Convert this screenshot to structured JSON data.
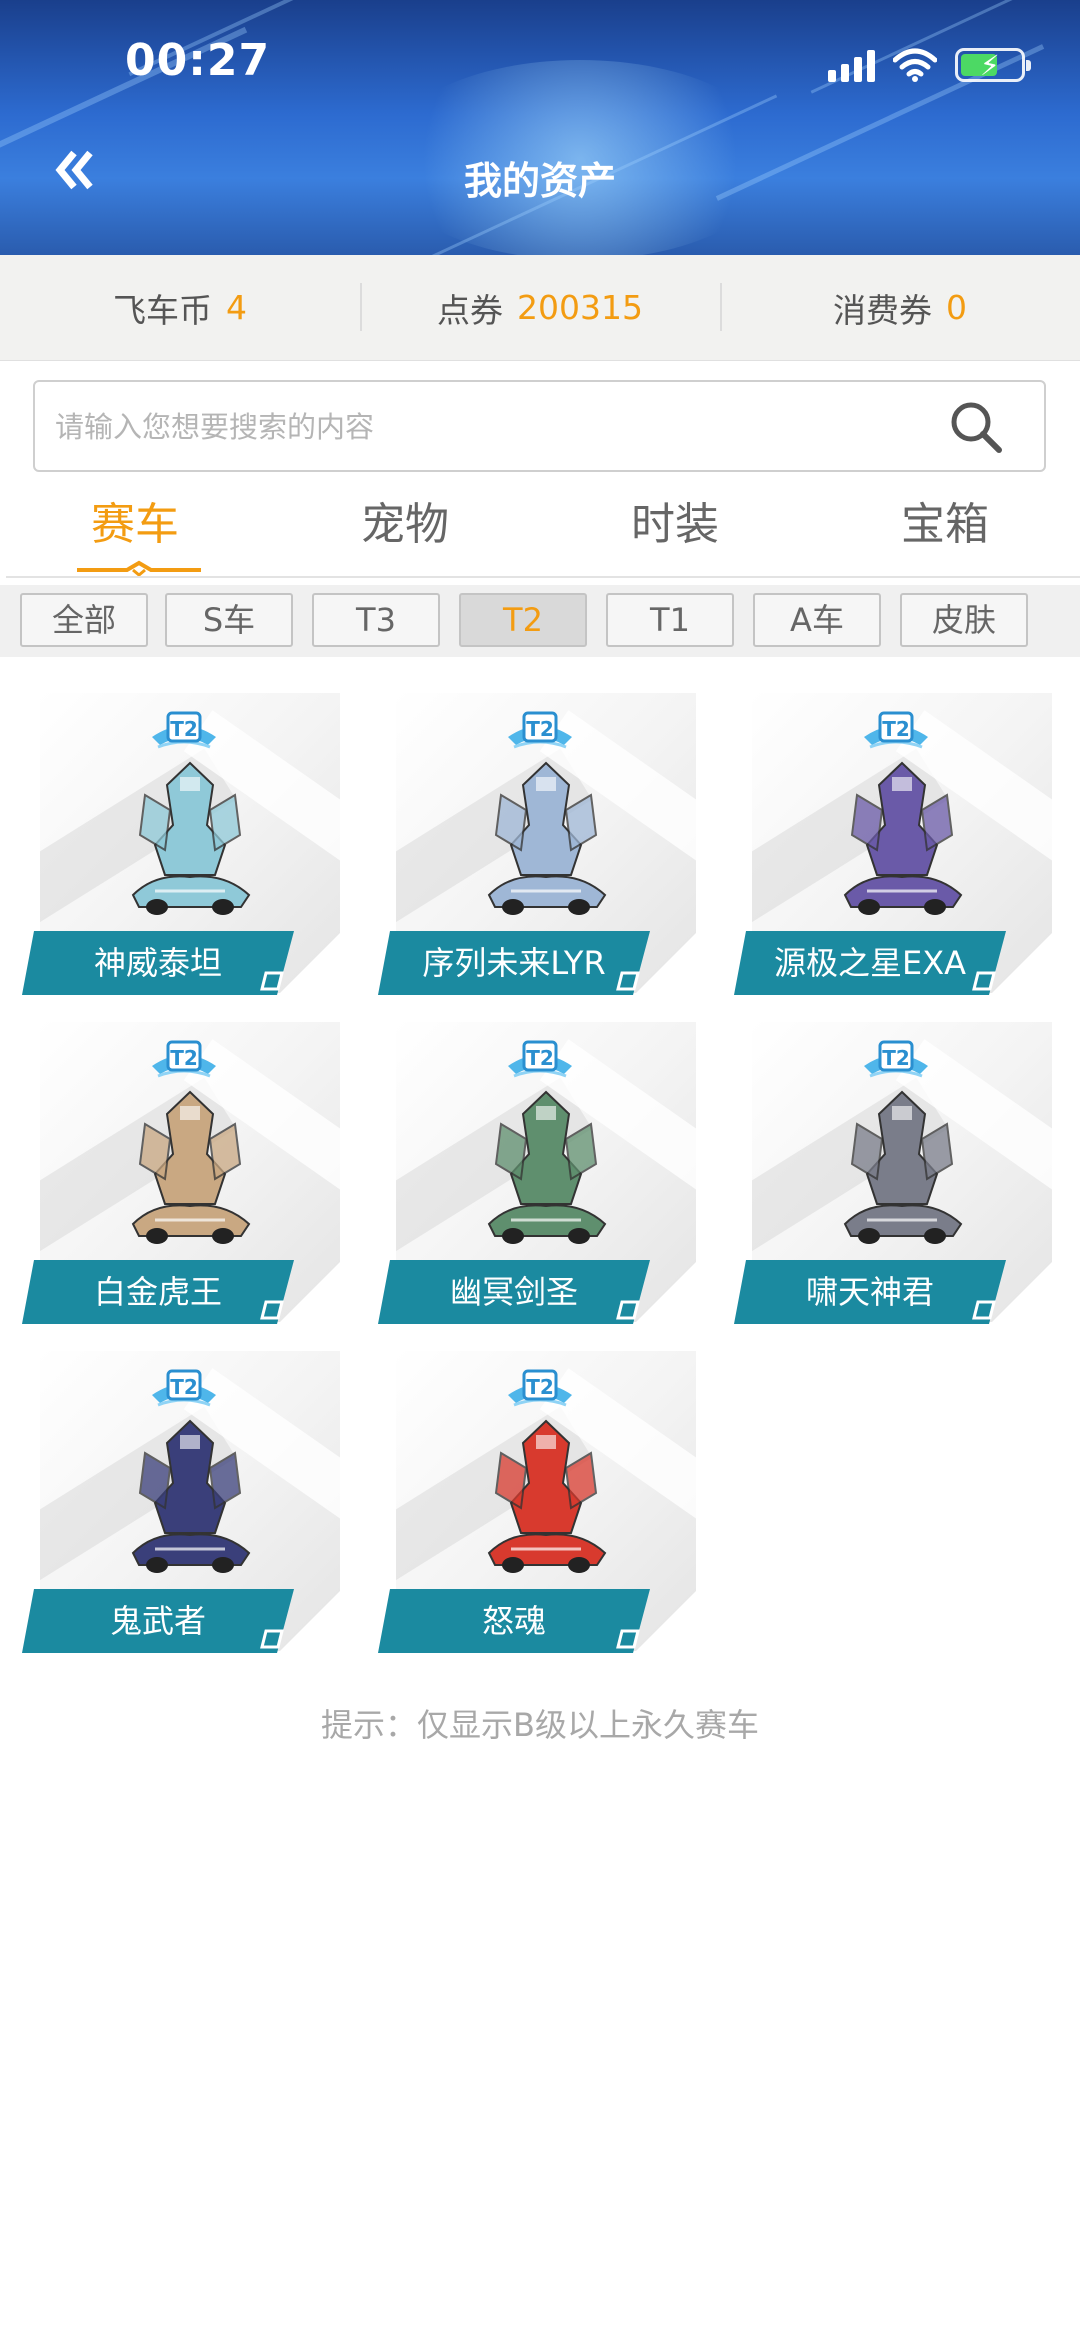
{
  "status_bar": {
    "time": "00:27"
  },
  "header": {
    "title": "我的资产",
    "back_icon": "double-chevron-left-icon"
  },
  "balance": [
    {
      "label": "飞车币",
      "value": "4"
    },
    {
      "label": "点券",
      "value": "200315"
    },
    {
      "label": "消费券",
      "value": "0"
    }
  ],
  "search": {
    "placeholder": "请输入您想要搜索的内容",
    "value": ""
  },
  "tabs": [
    {
      "label": "赛车",
      "active": true
    },
    {
      "label": "宠物",
      "active": false
    },
    {
      "label": "时装",
      "active": false
    },
    {
      "label": "宝箱",
      "active": false
    }
  ],
  "filters": [
    {
      "label": "全部",
      "active": false
    },
    {
      "label": "S车",
      "active": false
    },
    {
      "label": "T3",
      "active": false
    },
    {
      "label": "T2",
      "active": true
    },
    {
      "label": "T1",
      "active": false
    },
    {
      "label": "A车",
      "active": false
    },
    {
      "label": "皮肤",
      "active": false
    }
  ],
  "cars": [
    {
      "name": "神威泰坦",
      "badge": "T2",
      "color": "#8fc9d8"
    },
    {
      "name": "序列未来LYR",
      "badge": "T2",
      "color": "#9fb7d6"
    },
    {
      "name": "源极之星EXA",
      "badge": "T2",
      "color": "#6a5aa8"
    },
    {
      "name": "白金虎王",
      "badge": "T2",
      "color": "#c9a882"
    },
    {
      "name": "幽冥剑圣",
      "badge": "T2",
      "color": "#5f8f6e"
    },
    {
      "name": "啸天神君",
      "badge": "T2",
      "color": "#7a7d8a"
    },
    {
      "name": "鬼武者",
      "badge": "T2",
      "color": "#3a3f7a"
    },
    {
      "name": "怒魂",
      "badge": "T2",
      "color": "#d83a2e"
    }
  ],
  "hint": "提示：仅显示B级以上永久赛车",
  "colors": {
    "accent": "#f39c12",
    "label_bg": "#1b8aa0",
    "header": "#2d6bd0"
  }
}
